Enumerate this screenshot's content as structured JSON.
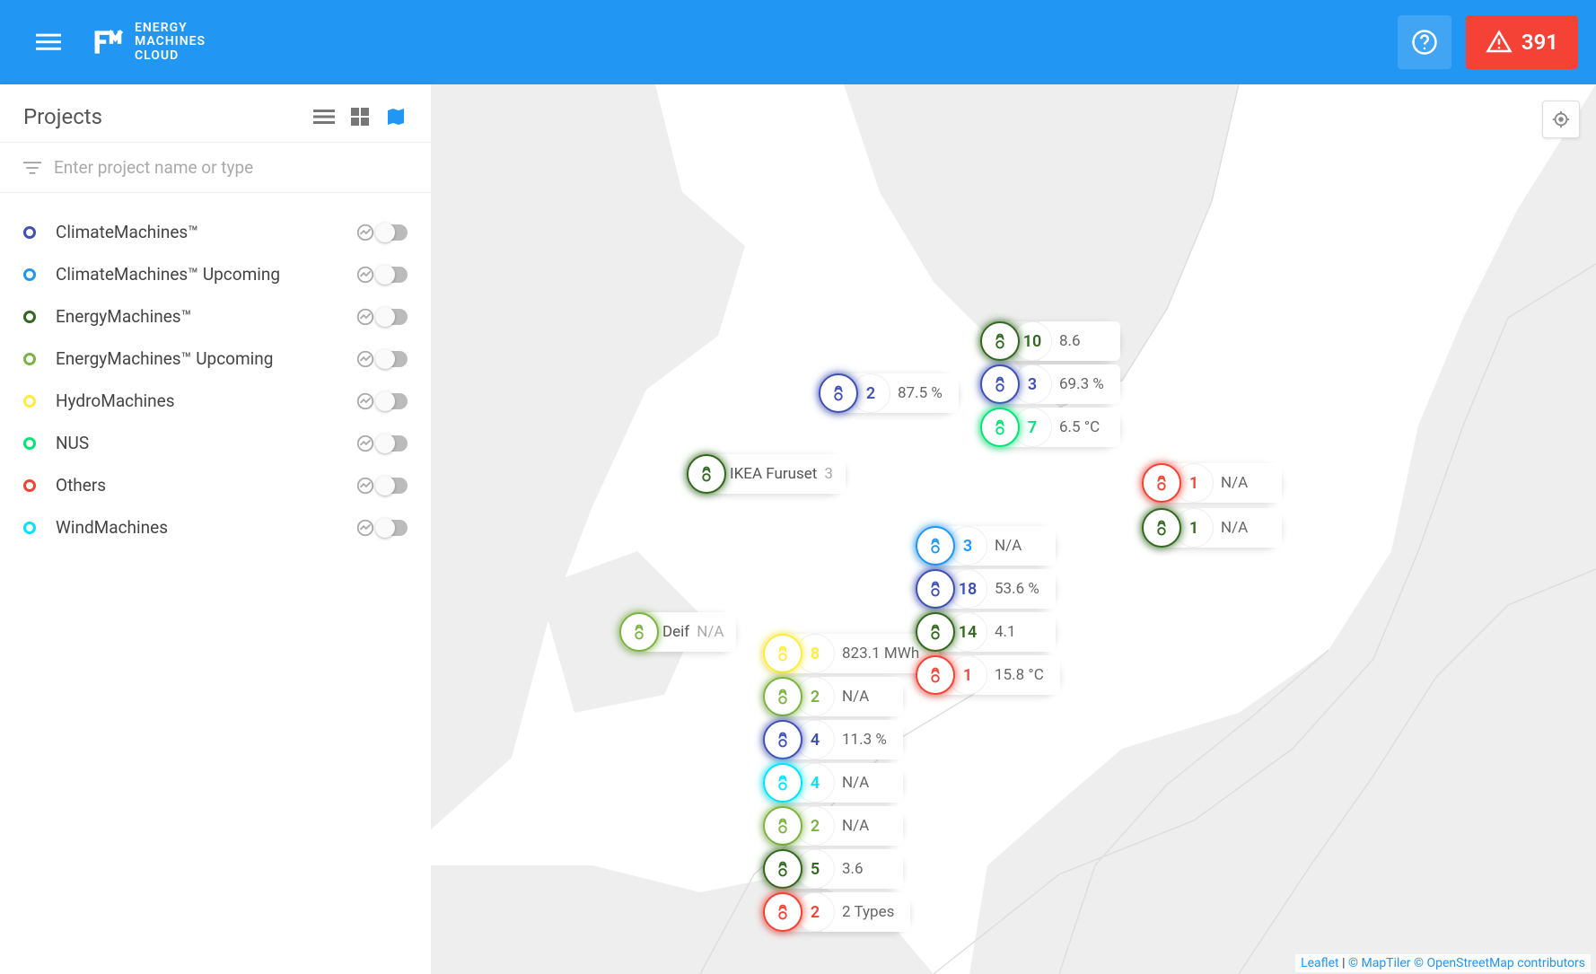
{
  "brand": {
    "line1": "ENERGY",
    "line2": "MACHINES",
    "line3": "CLOUD"
  },
  "header": {
    "alert_count": "391"
  },
  "sidebar": {
    "title": "Projects",
    "search_placeholder": "Enter project name or type",
    "items": [
      {
        "label": "ClimateMachines™",
        "color": "#3f51b5"
      },
      {
        "label": "ClimateMachines™ Upcoming",
        "color": "#2196f3"
      },
      {
        "label": "EnergyMachines™",
        "color": "#33691e"
      },
      {
        "label": "EnergyMachines™ Upcoming",
        "color": "#7cb342"
      },
      {
        "label": "HydroMachines",
        "color": "#ffeb3b"
      },
      {
        "label": "NUS",
        "color": "#00e676"
      },
      {
        "label": "Others",
        "color": "#f44336"
      },
      {
        "label": "WindMachines",
        "color": "#00e5ff"
      }
    ]
  },
  "map": {
    "attribution": {
      "leaflet": "Leaflet",
      "maptiler": "© MapTiler",
      "osm": "© OpenStreetMap contributors"
    },
    "markers": {
      "m_ikea": {
        "label": "IKEA Furuset",
        "sub": "3",
        "color": "#33691e"
      },
      "m_deif": {
        "label": "Deif",
        "sub": "N/A",
        "color": "#7cb342"
      },
      "m_top_2": {
        "count": "2",
        "value": "87.5 %",
        "color": "#3f51b5"
      },
      "m_ne_10": {
        "count": "10",
        "value": "8.6",
        "color": "#33691e"
      },
      "m_ne_3": {
        "count": "3",
        "value": "69.3 %",
        "color": "#3f51b5"
      },
      "m_ne_7": {
        "count": "7",
        "value": "6.5 °C",
        "color": "#00e676"
      },
      "m_e_1r": {
        "count": "1",
        "value": "N/A",
        "color": "#f44336"
      },
      "m_e_1g": {
        "count": "1",
        "value": "N/A",
        "color": "#33691e"
      },
      "m_c_3": {
        "count": "3",
        "value": "N/A",
        "color": "#2196f3"
      },
      "m_c_18": {
        "count": "18",
        "value": "53.6 %",
        "color": "#3f51b5"
      },
      "m_c_14": {
        "count": "14",
        "value": "4.1",
        "color": "#33691e"
      },
      "m_c_1": {
        "count": "1",
        "value": "15.8 °C",
        "color": "#f44336"
      },
      "m_s_8": {
        "count": "8",
        "value": "823.1 MWh",
        "color": "#ffeb3b"
      },
      "m_s_2a": {
        "count": "2",
        "value": "N/A",
        "color": "#7cb342"
      },
      "m_s_4a": {
        "count": "4",
        "value": "11.3 %",
        "color": "#3f51b5"
      },
      "m_s_4b": {
        "count": "4",
        "value": "N/A",
        "color": "#00e5ff"
      },
      "m_s_2b": {
        "count": "2",
        "value": "N/A",
        "color": "#7cb342"
      },
      "m_s_5": {
        "count": "5",
        "value": "3.6",
        "color": "#33691e"
      },
      "m_s_2c": {
        "count": "2",
        "value": "2 Types",
        "color": "#f44336"
      }
    }
  }
}
